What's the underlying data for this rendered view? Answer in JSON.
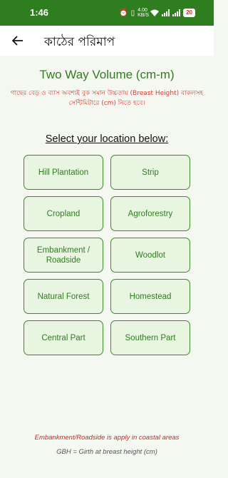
{
  "status": {
    "time": "1:46",
    "speed_value": "4.00",
    "speed_unit": "KB/S",
    "battery": "20",
    "icons": [
      "alarm-icon",
      "vibrate-icon",
      "wifi-icon",
      "signal-icon",
      "signal-icon",
      "battery-icon"
    ]
  },
  "app_bar": {
    "back_icon": "arrow-left-icon",
    "title": "কাঠের পরিমাপ"
  },
  "main": {
    "title": "Two Way Volume (cm-m)",
    "instruction": "গাছের বেড় ও ব্যাস অবশ্যই বুক সমান উচ্চতায় (Breast Height) বাকলসহ সেন্টিমিটারে (cm) নিতে হবে।",
    "select_label": "Select your location below:",
    "locations": [
      {
        "label": "Hill Plantation"
      },
      {
        "label": "Strip"
      },
      {
        "label": "Cropland"
      },
      {
        "label": "Agroforestry"
      },
      {
        "label": "Embankment /\nRoadside"
      },
      {
        "label": "Woodlot"
      },
      {
        "label": "Natural Forest"
      },
      {
        "label": "Homestead"
      },
      {
        "label": "Central Part"
      },
      {
        "label": "Southern Part"
      }
    ]
  },
  "footer": {
    "note": "Embankment/Roadside is apply in coastal areas",
    "gbh": "GBH = Girth at breast height (cm)"
  },
  "colors": {
    "primary_green": "#2e7d1f",
    "button_bg": "#e8f5e1",
    "warning_red": "#e53935"
  }
}
